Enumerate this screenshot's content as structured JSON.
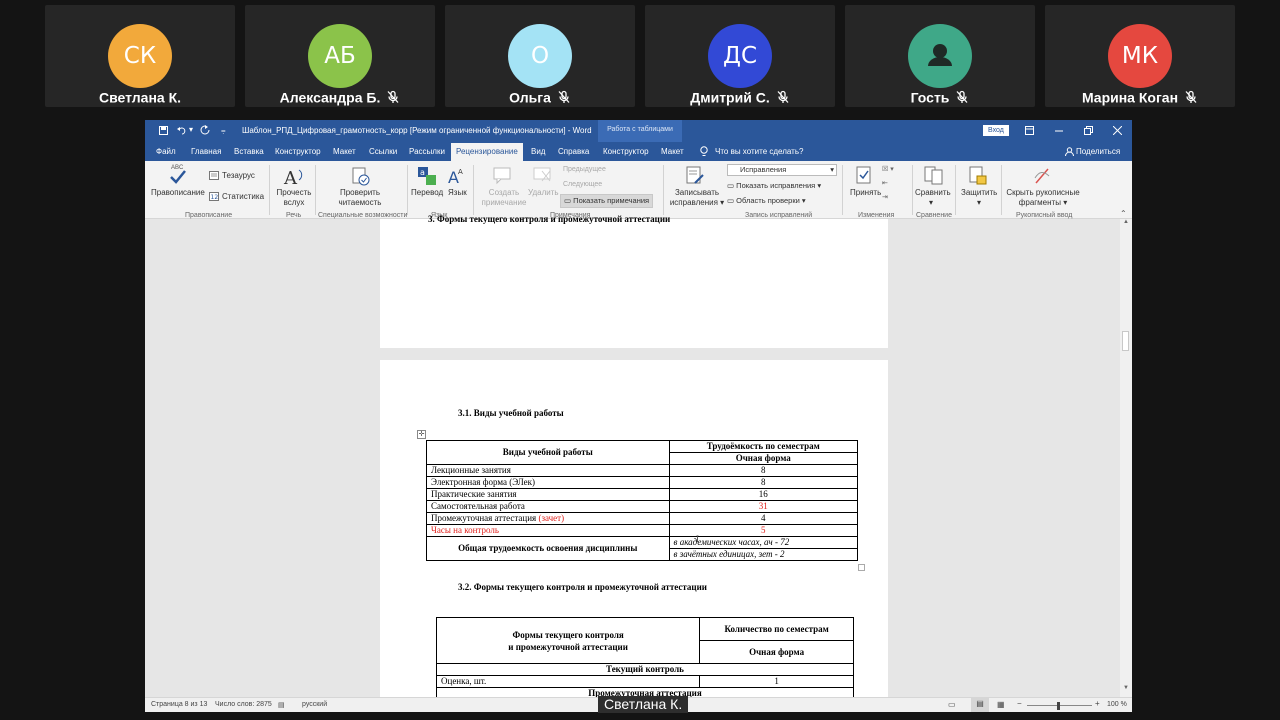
{
  "participants": [
    {
      "initials": "СК",
      "name": "Светлана К.",
      "color": "#f2a93b",
      "muted": false
    },
    {
      "initials": "АБ",
      "name": "Александра Б.",
      "color": "#8bc34a",
      "muted": true
    },
    {
      "initials": "О",
      "name": "Ольга",
      "color": "#a4e3f5",
      "muted": true
    },
    {
      "initials": "ДС",
      "name": "Дмитрий С.",
      "color": "#3249d6",
      "muted": true
    },
    {
      "initials": "",
      "name": "Гость",
      "color": "#3fa888",
      "muted": true
    },
    {
      "initials": "МК",
      "name": "Марина Коган",
      "color": "#e5483f",
      "muted": true
    }
  ],
  "speaker_caption": "Светлана К.",
  "word": {
    "title": "Шаблон_РПД_Цифровая_грамотность_корр [Режим ограниченной функциональности] - Word",
    "context_tab": "Работа с таблицами",
    "login": "Вход",
    "tabs": [
      "Файл",
      "Главная",
      "Вставка",
      "Конструктор",
      "Макет",
      "Ссылки",
      "Рассылки",
      "Рецензирование",
      "Вид",
      "Справка",
      "Конструктор",
      "Макет"
    ],
    "tell_me": "Что вы хотите сделать?",
    "share": "Поделиться",
    "ribbon": {
      "spelling": "Правописание",
      "thesaurus": "Тезаурус",
      "stats": "Статистика",
      "read_aloud_1": "Прочесть",
      "read_aloud_2": "вслух",
      "check_1": "Проверить",
      "check_2": "читаемость",
      "translate": "Перевод",
      "language": "Язык",
      "new_comment_1": "Создать",
      "new_comment_2": "примечание",
      "delete": "Удалить",
      "previous": "Предыдущее",
      "next": "Следующее",
      "show_comments": "Показать примечания",
      "track_1": "Записывать",
      "track_2": "исправления",
      "markup": "Исправления",
      "show_markup": "Показать исправления",
      "reviewing_pane": "Область проверки",
      "accept": "Принять",
      "compare": "Сравнить",
      "protect": "Защитить",
      "hide_ink_1": "Скрыть рукописные",
      "hide_ink_2": "фрагменты",
      "groups": {
        "proofing": "Правописание",
        "speech": "Речь",
        "accessibility": "Специальные возможности",
        "language": "Язык",
        "comments": "Примечания",
        "tracking": "Запись исправлений",
        "changes": "Изменения",
        "compare": "Сравнение",
        "ink": "Рукописный ввод"
      }
    },
    "status": {
      "page": "Страница 8 из 13",
      "words": "Число слов: 2875",
      "language": "русский",
      "zoom": "100 %"
    }
  },
  "document": {
    "prev_heading": "3. Формы текущего контроля и промежуточной аттестации",
    "section_31": "3.1. Виды учебной работы",
    "table1": {
      "head_col1": "Виды учебной работы",
      "head_col2_top": "Трудоёмкость по семестрам",
      "head_col2_bottom": "Очная форма",
      "rows": [
        {
          "name": "Лекционные занятия",
          "value": "8"
        },
        {
          "name": "Электронная форма (ЭЛек)",
          "value": "8"
        },
        {
          "name": "Практические занятия",
          "value": "16"
        },
        {
          "name": "Самостоятельная работа",
          "value": "31"
        },
        {
          "name": "Промежуточная аттестация",
          "name_extra": "(зачет)",
          "value": "4"
        },
        {
          "name": "Часы на контроль",
          "value": "5"
        }
      ],
      "total_label": "Общая трудоемкость освоения дисциплины",
      "total_hours": "в академических часах, ач - 72",
      "total_credits": "в зачётных единицах, зет - 2"
    },
    "section_32": "3.2. Формы текущего контроля и промежуточной аттестации",
    "table2": {
      "head_col1_line1": "Формы текущего контроля",
      "head_col1_line2": "и промежуточной аттестации",
      "head_col2_top": "Количество по семестрам",
      "head_col2_bottom": "Очная форма",
      "current_control": "Текущий контроль",
      "row_name": "Оценка, шт.",
      "row_value": "1",
      "interim": "Промежуточная аттестация"
    }
  }
}
